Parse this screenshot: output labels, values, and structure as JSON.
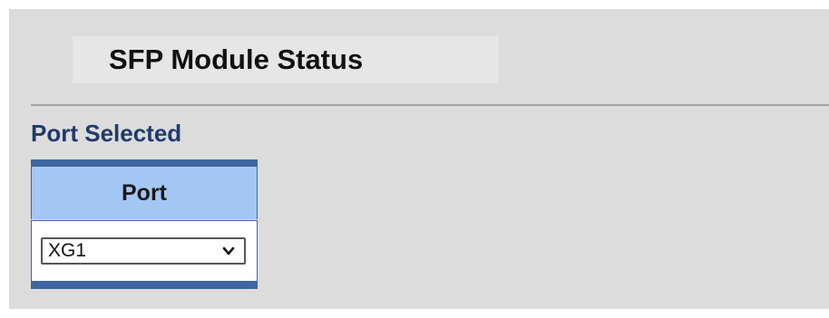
{
  "page": {
    "title": "SFP Module Status",
    "section_label": "Port Selected"
  },
  "port_table": {
    "header": "Port",
    "select": {
      "value": "XG1",
      "icon": "chevron-down-icon"
    }
  },
  "colors": {
    "background": "#dcdcdc",
    "title_box": "#e6e6e6",
    "section_label": "#1f3a6e",
    "table_border": "#3f66a0",
    "table_header": "#a3c6f5"
  }
}
